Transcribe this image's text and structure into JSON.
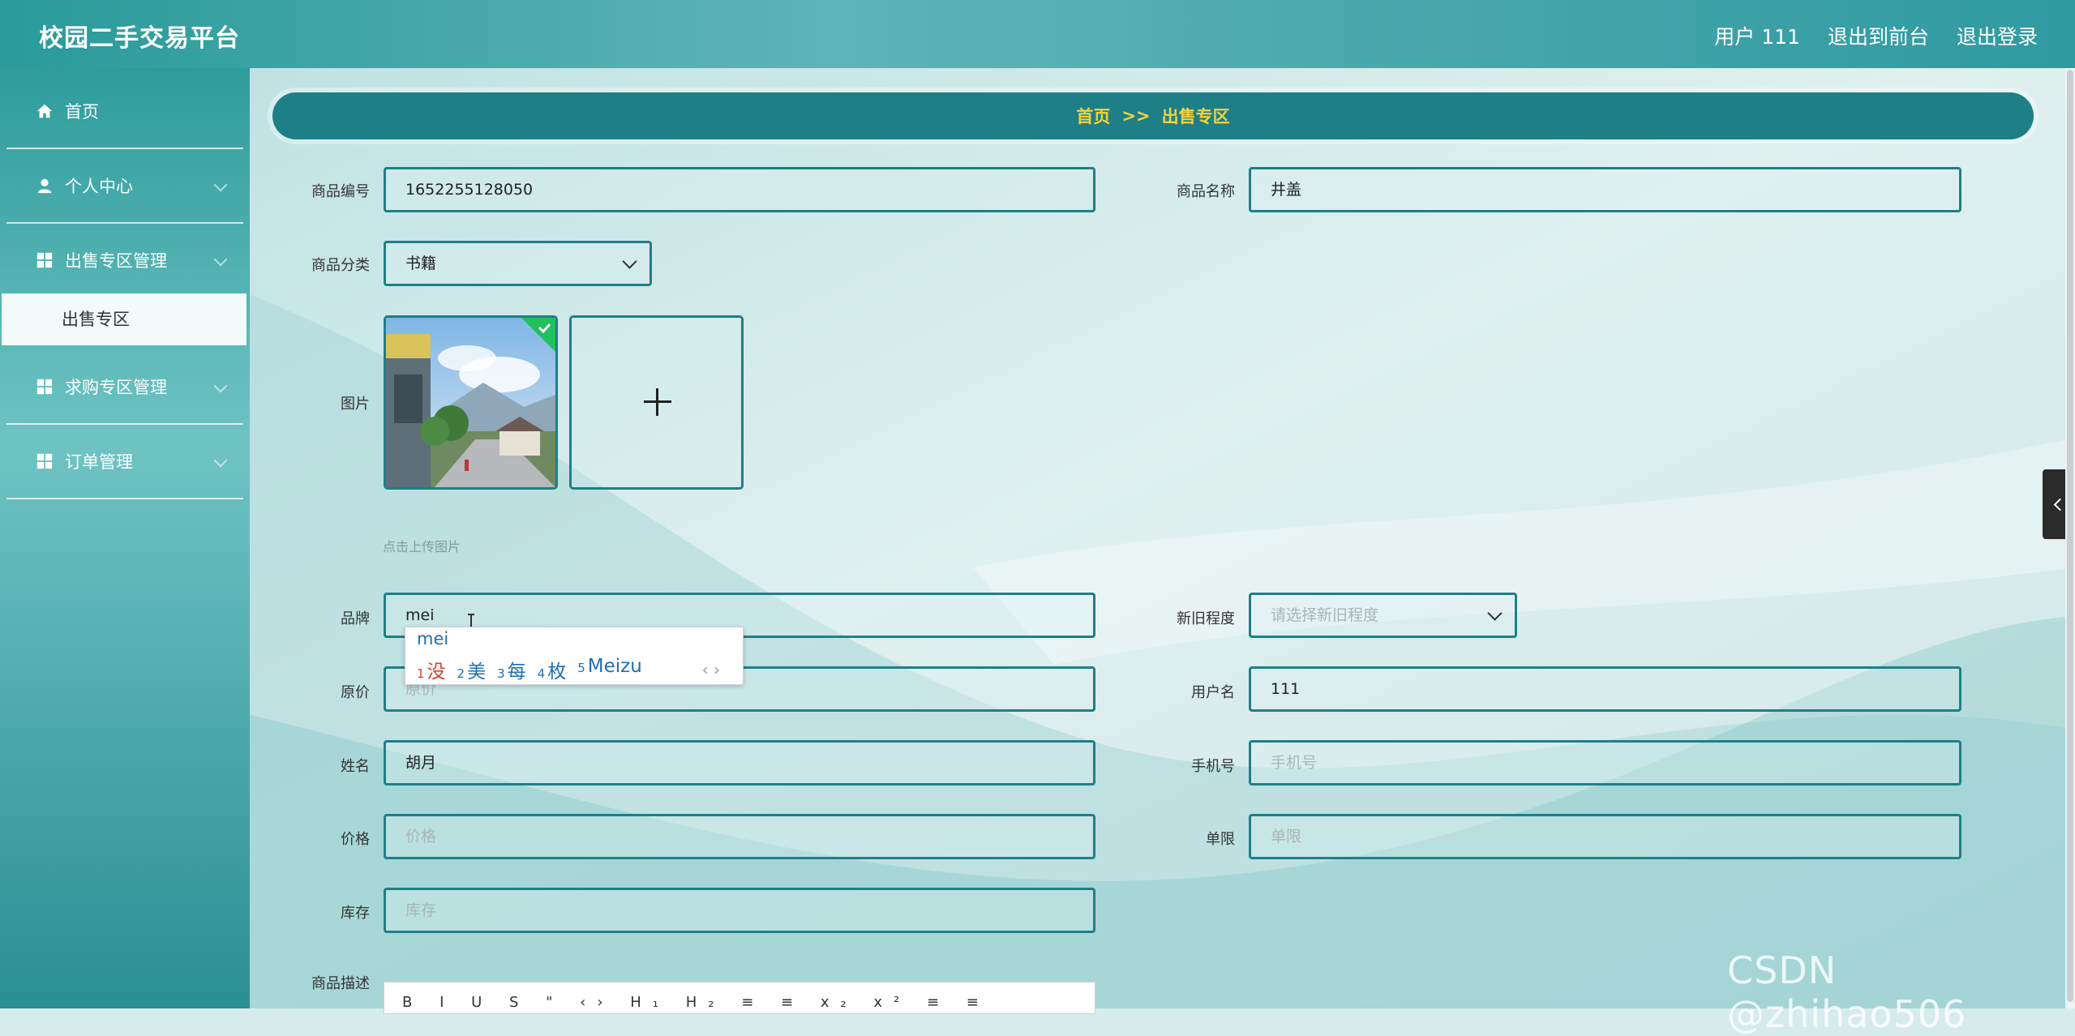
{
  "app": {
    "title": "校园二手交易平台"
  },
  "header": {
    "user_label": "用户 111",
    "back_to_front": "退出到前台",
    "logout": "退出登录"
  },
  "sidebar": {
    "items": [
      {
        "label": "首页",
        "icon": "home-icon"
      },
      {
        "label": "个人中心",
        "icon": "user-icon"
      },
      {
        "label": "出售专区管理",
        "icon": "grid-icon"
      },
      {
        "label": "求购专区管理",
        "icon": "grid-icon"
      },
      {
        "label": "订单管理",
        "icon": "grid-icon"
      }
    ],
    "active_sub": "出售专区"
  },
  "breadcrumb": {
    "home": "首页",
    "sep": ">>",
    "current": "出售专区"
  },
  "form": {
    "product_code": {
      "label": "商品编号",
      "value": "1652255128050"
    },
    "product_name": {
      "label": "商品名称",
      "value": "井盖"
    },
    "category": {
      "label": "商品分类",
      "value": "书籍"
    },
    "image": {
      "label": "图片",
      "hint": "点击上传图片"
    },
    "brand": {
      "label": "品牌",
      "value": "mei"
    },
    "condition": {
      "label": "新旧程度",
      "placeholder": "请选择新旧程度"
    },
    "original_price": {
      "label": "原价",
      "placeholder": "原价"
    },
    "username": {
      "label": "用户名",
      "value": "111"
    },
    "name": {
      "label": "姓名",
      "value": "胡月"
    },
    "phone": {
      "label": "手机号",
      "placeholder": "手机号"
    },
    "price": {
      "label": "价格",
      "placeholder": "价格"
    },
    "limit": {
      "label": "单限",
      "placeholder": "单限"
    },
    "stock": {
      "label": "库存",
      "placeholder": "库存"
    },
    "description": {
      "label": "商品描述",
      "toolbar": "B I U S \" ‹› H₁ H₂ ≡ ≡ x₂ x² ≡ ≡"
    }
  },
  "ime": {
    "composition": "mei",
    "candidates": [
      {
        "n": "1",
        "text": "没"
      },
      {
        "n": "2",
        "text": "美"
      },
      {
        "n": "3",
        "text": "每"
      },
      {
        "n": "4",
        "text": "枚"
      },
      {
        "n": "5",
        "text": "Meizu"
      }
    ],
    "nav": "‹ ›"
  },
  "watermark": "CSDN @zhihao506",
  "colors": {
    "accent": "#1f7f87",
    "breadcrumb_text": "#f3d33a",
    "header": "#4aa9ad"
  }
}
